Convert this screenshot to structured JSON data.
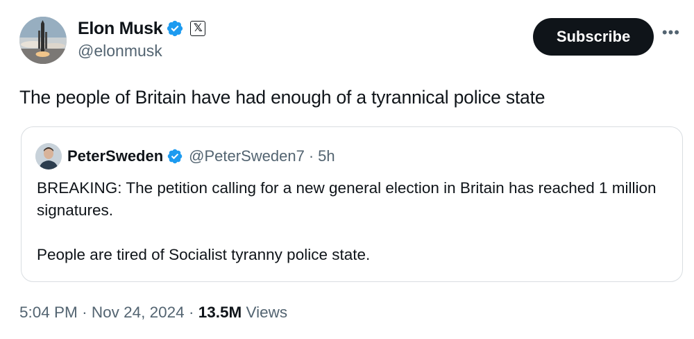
{
  "author": {
    "display_name": "Elon Musk",
    "handle": "@elonmusk",
    "badges": [
      "verified-checkmark-icon",
      "x-logo-icon"
    ],
    "x_badge_glyph": "𝕏"
  },
  "actions": {
    "subscribe_label": "Subscribe",
    "more_label": "•••"
  },
  "tweet": {
    "text": "The people of Britain have had enough of a tyrannical police state"
  },
  "quoted_tweet": {
    "display_name": "PeterSweden",
    "handle": "@PeterSweden7",
    "separator": "·",
    "time_ago": "5h",
    "paragraph_1": "BREAKING: The petition calling for a new general election in Britain has reached 1 million signatures.",
    "paragraph_2": "People are tired of Socialist tyranny police state."
  },
  "footer": {
    "time": "5:04 PM",
    "separator": "·",
    "date": "Nov 24, 2024",
    "views_count": "13.5M",
    "views_label": "Views"
  },
  "colors": {
    "verified_blue": "#1d9bf0",
    "text_primary": "#0f1419",
    "text_secondary": "#536471",
    "border": "#d9dde1"
  }
}
